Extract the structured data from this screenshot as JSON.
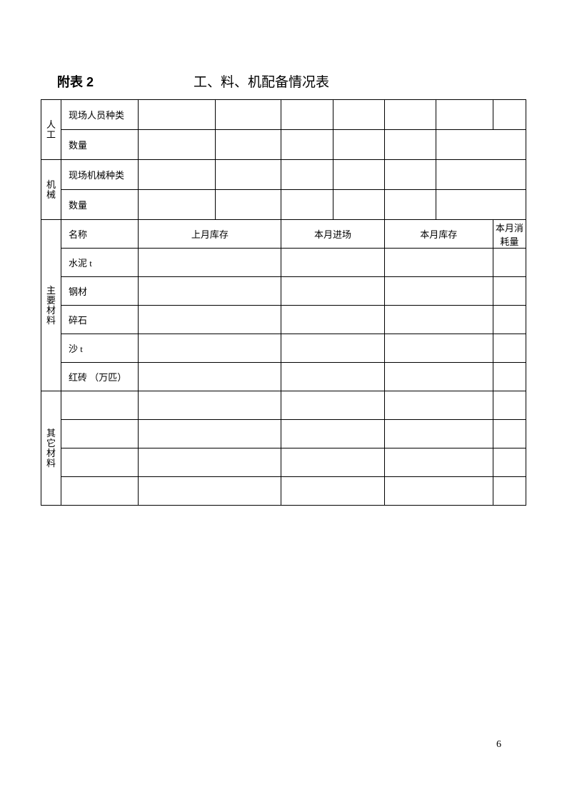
{
  "header": {
    "label": "附表 2",
    "title": "工、料、机配备情况表"
  },
  "sections": {
    "personnel_label": "人工",
    "machine_label": "机械",
    "main_material_label": "主要材料",
    "other_material_label": "其它材料"
  },
  "rows": {
    "personnel_type": "现场人员种类",
    "personnel_qty": "数量",
    "machine_type": "现场机械种类",
    "machine_qty": "数量",
    "material_name": "名称",
    "last_month_stock": "上月库存",
    "this_month_in": "本月进场",
    "this_month_stock": "本月库存",
    "this_month_consumed": "本月消耗量",
    "cement": "水泥  t",
    "steel": "钢材",
    "gravel": "碎石",
    "sand": "沙  t",
    "brick": "红砖  （万匹）"
  },
  "page_number": "6"
}
